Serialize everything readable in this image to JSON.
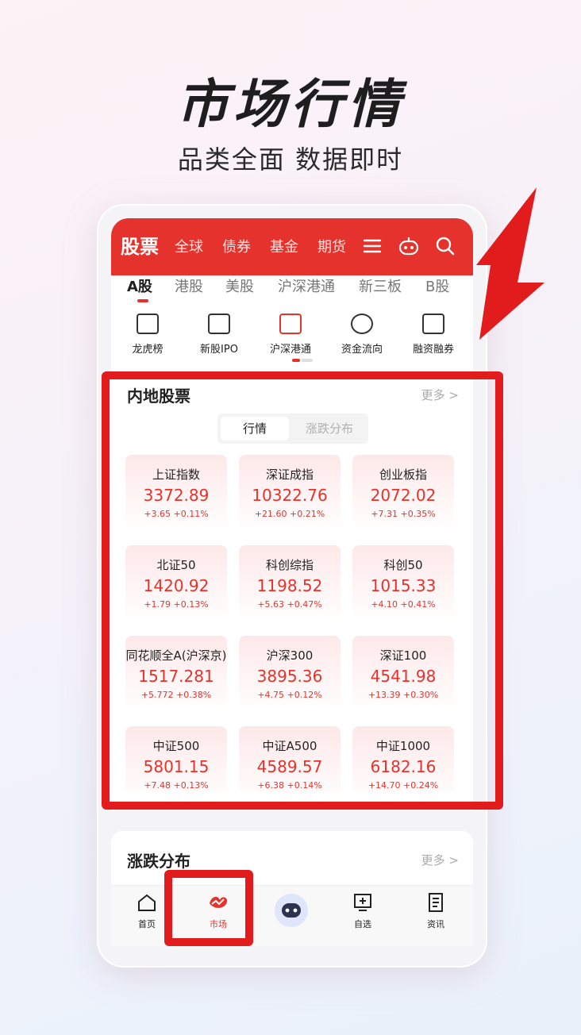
{
  "headline": "市场行情",
  "subline": "品类全面 数据即时",
  "topbar": {
    "tabs": [
      "股票",
      "全球",
      "债券",
      "基金",
      "期货"
    ],
    "icons": [
      "menu-icon",
      "robot-icon",
      "search-icon"
    ]
  },
  "subtabs": [
    "A股",
    "港股",
    "美股",
    "沪深港通",
    "新三板",
    "B股"
  ],
  "shortcuts": [
    {
      "label": "龙虎榜",
      "icon": "ranking-icon"
    },
    {
      "label": "新股IPO",
      "icon": "ipo-icon"
    },
    {
      "label": "沪深港通",
      "icon": "connect-icon"
    },
    {
      "label": "资金流向",
      "icon": "money-flow-icon"
    },
    {
      "label": "融资融券",
      "icon": "margin-icon"
    }
  ],
  "panel": {
    "title": "内地股票",
    "more": "更多 >",
    "seg_on": "行情",
    "seg_off": "涨跌分布"
  },
  "indices": [
    {
      "name": "上证指数",
      "price": "3372.89",
      "change": "+3.65  +0.11%"
    },
    {
      "name": "深证成指",
      "price": "10322.76",
      "change": "+21.60  +0.21%"
    },
    {
      "name": "创业板指",
      "price": "2072.02",
      "change": "+7.31  +0.35%"
    },
    {
      "name": "北证50",
      "price": "1420.92",
      "change": "+1.79  +0.13%"
    },
    {
      "name": "科创综指",
      "price": "1198.52",
      "change": "+5.63  +0.47%"
    },
    {
      "name": "科创50",
      "price": "1015.33",
      "change": "+4.10  +0.41%"
    },
    {
      "name": "同花顺全A(沪深京)",
      "price": "1517.281",
      "change": "+5.772  +0.38%"
    },
    {
      "name": "沪深300",
      "price": "3895.36",
      "change": "+4.75  +0.12%"
    },
    {
      "name": "深证100",
      "price": "4541.98",
      "change": "+13.39  +0.30%"
    },
    {
      "name": "中证500",
      "price": "5801.15",
      "change": "+7.48  +0.13%"
    },
    {
      "name": "中证A500",
      "price": "4589.57",
      "change": "+6.38  +0.14%"
    },
    {
      "name": "中证1000",
      "price": "6182.16",
      "change": "+14.70  +0.24%"
    }
  ],
  "section2": {
    "title": "涨跌分布",
    "more": "更多 >"
  },
  "bottomnav": [
    {
      "label": "首页",
      "icon": "home-icon"
    },
    {
      "label": "市场",
      "icon": "market-icon",
      "active": true
    },
    {
      "label": "",
      "icon": "assistant-robot-icon"
    },
    {
      "label": "自选",
      "icon": "watchlist-icon"
    },
    {
      "label": "资讯",
      "icon": "news-icon"
    }
  ],
  "colors": {
    "accent": "#e5322d",
    "highlight": "#e21c1c"
  }
}
